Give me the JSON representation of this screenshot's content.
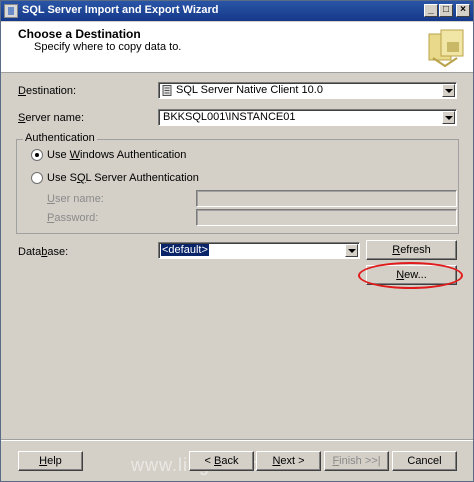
{
  "window": {
    "title": "SQL Server Import and Export Wizard"
  },
  "titlebar": {
    "minimize_glyph": "_",
    "maximize_glyph": "□",
    "close_glyph": "×"
  },
  "header": {
    "title": "Choose a Destination",
    "subtitle": "Specify where to copy data to."
  },
  "destination": {
    "label_prefix": "",
    "label_accel": "D",
    "label_rest": "estination:",
    "value": "SQL Server Native Client 10.0"
  },
  "server": {
    "label_prefix": "",
    "label_accel": "S",
    "label_rest": "erver name:",
    "value": "BKKSQL001\\INSTANCE01"
  },
  "authentication": {
    "group_title": "Authentication",
    "windows": {
      "prefix": "Use ",
      "accel": "W",
      "rest": "indows Authentication",
      "selected": true
    },
    "sql": {
      "prefix": "Use S",
      "accel": "Q",
      "rest": "L Server Authentication",
      "selected": false
    },
    "user_name": {
      "prefix": "",
      "accel": "U",
      "rest": "ser name:",
      "value": ""
    },
    "password": {
      "prefix": "",
      "accel": "P",
      "rest": "assword:",
      "value": ""
    }
  },
  "database": {
    "label_prefix": "Data",
    "label_accel": "b",
    "label_rest": "ase:",
    "value": "<default>",
    "refresh": {
      "prefix": "",
      "accel": "R",
      "rest": "efresh"
    },
    "new": {
      "prefix": "",
      "accel": "N",
      "rest": "ew..."
    }
  },
  "footer": {
    "help": {
      "prefix": "",
      "accel": "H",
      "rest": "elp"
    },
    "back": {
      "prefix": "< ",
      "accel": "B",
      "rest": "ack"
    },
    "next": {
      "prefix": "",
      "accel": "N",
      "rest": "ext >"
    },
    "finish": {
      "prefix": "",
      "accel": "F",
      "rest": "inish >>|"
    },
    "cancel": {
      "label": "Cancel"
    }
  },
  "watermark": "www.lingfom.com",
  "colors": {
    "titlebar": "#16398a",
    "highlight": "#0a246a",
    "annotation": "#e11b1b"
  }
}
